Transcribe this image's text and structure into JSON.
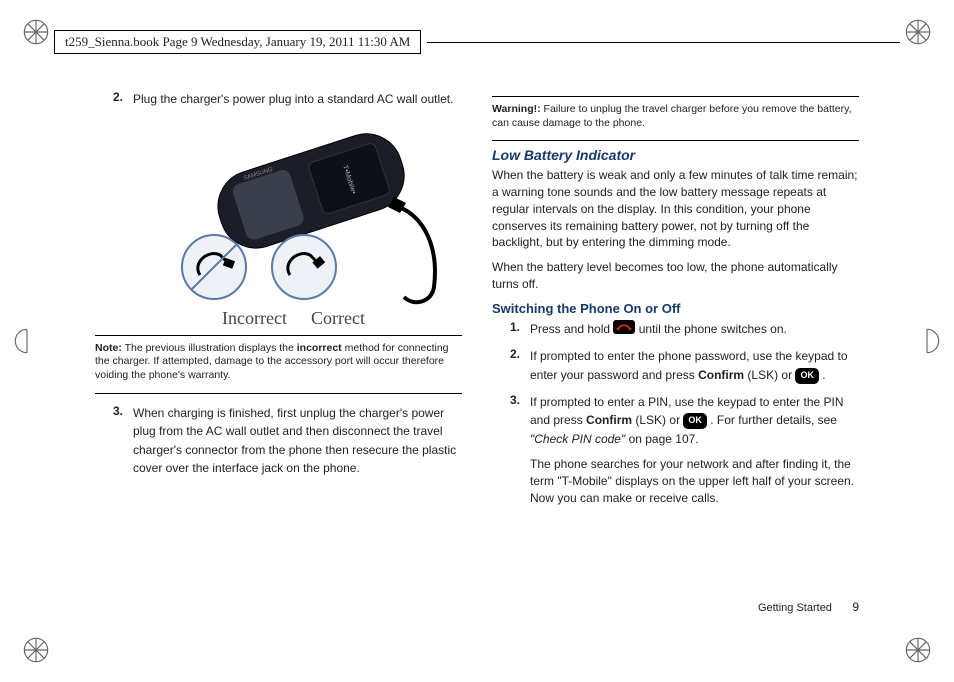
{
  "header": {
    "text": "t259_Sienna.book  Page 9  Wednesday, January 19, 2011  11:30 AM"
  },
  "left": {
    "step2": {
      "num": "2.",
      "text": "Plug the charger's power plug into a standard AC wall outlet."
    },
    "caption_incorrect": "Incorrect",
    "caption_correct": "Correct",
    "note": {
      "label": "Note:",
      "text_a": "The previous illustration displays the ",
      "text_bold": "incorrect",
      "text_b": " method for connecting the charger. If attempted, damage to the accessory port will occur therefore voiding the phone's warranty."
    },
    "step3": {
      "num": "3.",
      "text": "When charging is finished, first unplug the charger's power plug from the AC wall outlet and then disconnect the travel charger's connector from the phone then resecure the plastic cover over the interface jack on the phone."
    }
  },
  "right": {
    "warn": {
      "label": "Warning!:",
      "text": "Failure to unplug the travel charger before you remove the battery, can cause damage to the phone."
    },
    "h_low": "Low Battery Indicator",
    "p1": "When the battery is weak and only a few minutes of talk time remain; a warning tone sounds and the low battery message repeats at regular intervals on the display. In this condition, your phone conserves its remaining battery power, not by turning off the backlight, but by entering the dimming mode.",
    "p2": "When the battery level becomes too low, the phone automatically turns off.",
    "h_switch": "Switching the Phone On or Off",
    "s1": {
      "num": "1.",
      "a": "Press and hold ",
      "b": " until the phone switches on."
    },
    "s2": {
      "num": "2.",
      "a": "If prompted to enter the phone password, use the keypad to enter your password and press ",
      "confirm": "Confirm",
      "b": " (LSK) or ",
      "c": "."
    },
    "s3": {
      "num": "3.",
      "a": "If prompted to enter a PIN, use the keypad to enter the PIN and press ",
      "confirm": "Confirm",
      "b": " (LSK) or ",
      "c": ". For further details, see ",
      "xref": "\"Check PIN code\"",
      "d": " on page 107."
    },
    "s3p": "The phone searches for your network and after finding it, the term \"T-Mobile\" displays on the upper left half of your screen. Now you can make or receive calls."
  },
  "icons": {
    "ok": "OK"
  },
  "footer": {
    "section": "Getting Started",
    "page": "9"
  }
}
